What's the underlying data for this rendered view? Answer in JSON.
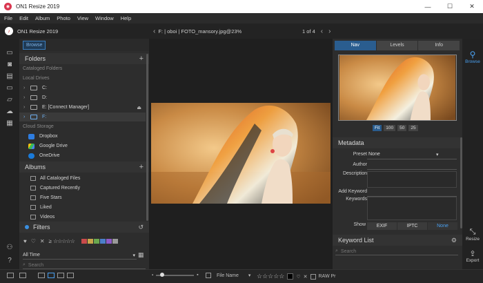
{
  "window": {
    "title": "ON1 Resize 2019",
    "minimize": "—",
    "maximize": "☐",
    "close": "✕"
  },
  "menu": [
    "File",
    "Edit",
    "Album",
    "Photo",
    "View",
    "Window",
    "Help"
  ],
  "header": {
    "app_name": "ON1 Resize 2019",
    "breadcrumb": "F:  |  oboi  |  FOTO_mansory.jpg@23%",
    "page_indicator": "1 of 4"
  },
  "left": {
    "tab": "Browse",
    "folders": {
      "title": "Folders",
      "cataloged_label": "Cataloged Folders",
      "local_label": "Local Drives",
      "drives": [
        "C:",
        "D:",
        "E: [Connect Manager]",
        "F:"
      ],
      "cloud_label": "Cloud Storage",
      "cloud": [
        "Dropbox",
        "Google Drive",
        "OneDrive"
      ]
    },
    "albums": {
      "title": "Albums",
      "items": [
        "All Cataloged Files",
        "Captured Recently",
        "Five Stars",
        "Liked",
        "Videos"
      ]
    },
    "filters": {
      "title": "Filters",
      "rating_op": "≥",
      "stars": "☆☆☆☆☆",
      "time": "All Time",
      "search_placeholder": "Search",
      "label_colors": [
        "#c94b4b",
        "#c9a64b",
        "#6aa84f",
        "#4b7fc9",
        "#8e5bc9",
        "#999999"
      ]
    }
  },
  "right": {
    "tabs": [
      "Nav",
      "Levels",
      "Info"
    ],
    "active_tab": "Nav",
    "zoom": [
      "Fit",
      "100",
      "50",
      "25"
    ],
    "metadata": {
      "title": "Metadata",
      "preset_label": "Preset",
      "preset_value": "None",
      "author_label": "Author",
      "description_label": "Description",
      "add_keyword_label": "Add Keyword",
      "keywords_label": "Keywords",
      "show_label": "Show",
      "show_options": [
        "EXIF",
        "IPTC",
        "None"
      ]
    },
    "keyword_list": {
      "title": "Keyword List",
      "search_placeholder": "Search"
    }
  },
  "right_strip": {
    "browse": "Browse",
    "resize": "Resize",
    "export": "Export"
  },
  "bottom": {
    "sort_by": "File Name",
    "stars": "☆☆☆☆☆",
    "raw_label": "RAW Pr"
  }
}
